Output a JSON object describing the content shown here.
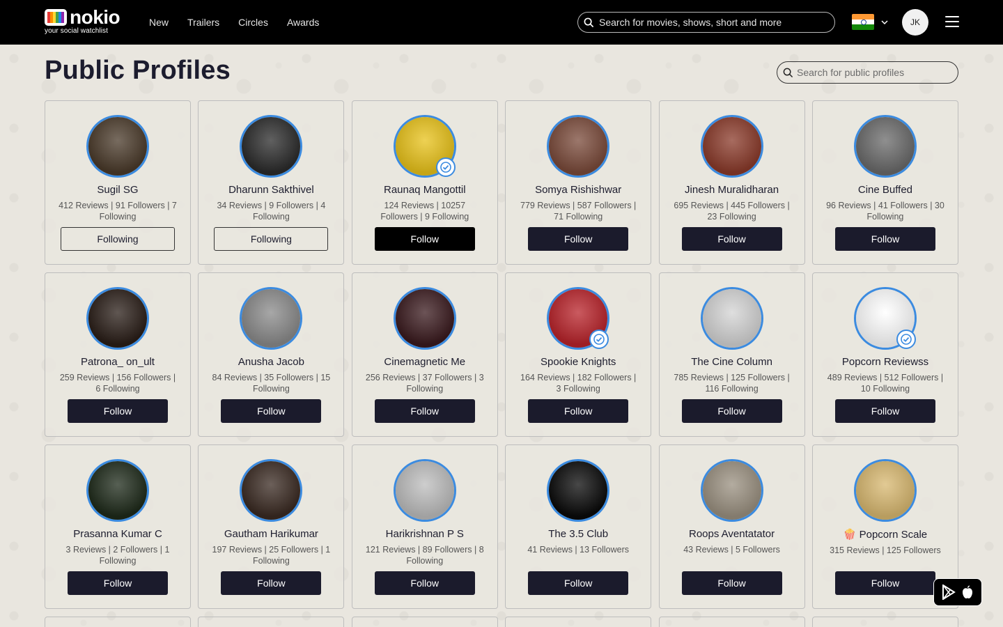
{
  "header": {
    "logo_word": "nokio",
    "logo_tagline": "your social watchlist",
    "nav": [
      "New",
      "Trailers",
      "Circles",
      "Awards"
    ],
    "search_placeholder": "Search for movies, shows, short and more",
    "user_initials": "JK",
    "country": "India"
  },
  "page": {
    "title": "Public Profiles",
    "search_placeholder": "Search for public profiles"
  },
  "colors": {
    "accent_ring": "#3b8be0",
    "button_dark": "#1b1b2c"
  },
  "profiles": [
    {
      "name": "Sugil SG",
      "stats": "412 Reviews | 91 Followers | 7 Following",
      "button": "Following",
      "verified": false,
      "avatar": "#4a3a2a"
    },
    {
      "name": "Dharunn Sakthivel",
      "stats": "34 Reviews | 9 Followers | 4 Following",
      "button": "Following",
      "verified": false,
      "avatar": "#2b2b2b"
    },
    {
      "name": "Raunaq Mangottil",
      "stats": "124 Reviews | 10257 Followers | 9 Following",
      "button": "Follow",
      "verified": true,
      "avatar": "#e8c21a"
    },
    {
      "name": "Somya Rishishwar",
      "stats": "779 Reviews | 587 Followers | 71 Following",
      "button": "Follow",
      "verified": false,
      "avatar": "#7a4a3a"
    },
    {
      "name": "Jinesh Muralidharan",
      "stats": "695 Reviews | 445 Followers | 23 Following",
      "button": "Follow",
      "verified": false,
      "avatar": "#8a3a2a"
    },
    {
      "name": "Cine Buffed",
      "stats": "96 Reviews | 41 Followers | 30 Following",
      "button": "Follow",
      "verified": false,
      "avatar": "#6a6a6a"
    },
    {
      "name": "Patrona_ on_ult",
      "stats": "259 Reviews | 156 Followers | 6 Following",
      "button": "Follow",
      "verified": false,
      "avatar": "#2a1e18"
    },
    {
      "name": "Anusha Jacob",
      "stats": "84 Reviews | 35 Followers | 15 Following",
      "button": "Follow",
      "verified": false,
      "avatar": "#8a8a8a"
    },
    {
      "name": "Cinemagnetic Me",
      "stats": "256 Reviews | 37 Followers | 3 Following",
      "button": "Follow",
      "verified": false,
      "avatar": "#3a1a1e"
    },
    {
      "name": "Spookie Knights",
      "stats": "164 Reviews | 182 Followers | 3 Following",
      "button": "Follow",
      "verified": true,
      "avatar": "#b8232a"
    },
    {
      "name": "The Cine Column",
      "stats": "785 Reviews | 125 Followers | 116 Following",
      "button": "Follow",
      "verified": false,
      "avatar": "#d4d4d4"
    },
    {
      "name": "Popcorn Reviewss",
      "stats": "489 Reviews | 512 Followers | 10 Following",
      "button": "Follow",
      "verified": true,
      "avatar": "#ffffff"
    },
    {
      "name": "Prasanna Kumar C",
      "stats": "3 Reviews | 2 Followers | 1 Following",
      "button": "Follow",
      "verified": false,
      "avatar": "#1e2a1a"
    },
    {
      "name": "Gautham Harikumar",
      "stats": "197 Reviews | 25 Followers | 1 Following",
      "button": "Follow",
      "verified": false,
      "avatar": "#3a2a22"
    },
    {
      "name": "Harikrishnan P S",
      "stats": "121 Reviews | 89 Followers | 8 Following",
      "button": "Follow",
      "verified": false,
      "avatar": "#bdbdbd"
    },
    {
      "name": "The 3.5 Club",
      "stats": "41 Reviews | 13 Followers",
      "button": "Follow",
      "verified": false,
      "avatar": "#0a0a0a"
    },
    {
      "name": "Roops Aventatator",
      "stats": "43 Reviews | 5 Followers",
      "button": "Follow",
      "verified": false,
      "avatar": "#9a9080"
    },
    {
      "name": "🍿 Popcorn Scale",
      "stats": "315 Reviews | 125 Followers",
      "button": "Follow",
      "verified": false,
      "avatar": "#d8b870"
    }
  ]
}
